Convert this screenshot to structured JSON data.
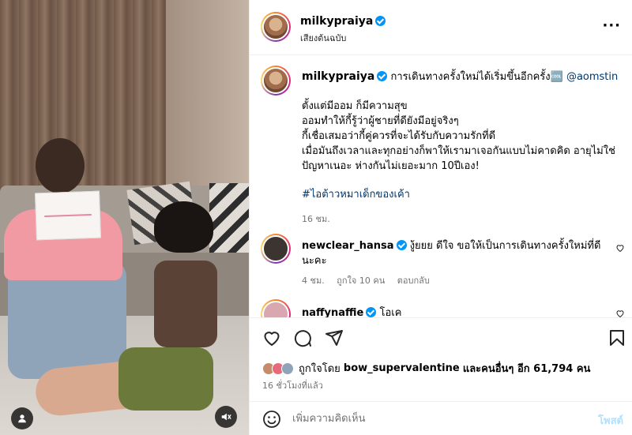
{
  "post": {
    "username": "milkypraiya",
    "audio_label": "เสียงต้นฉบับ",
    "caption_headline": "การเดินทางครั้งใหม่ได้เริ่มขึ้นอีกครั้ง",
    "caption_gif_glyph": "🆒",
    "caption_mention": "@aomstin",
    "caption_lines": [
      "ตั้งแต่มีออม ก็มีความสุข",
      "ออมทำให้กี้รู้ว่าผู้ชายที่ดียังมีอยู่จริงๆ",
      "กี้เชื่อเสมอว่ากี้คู่ควรที่จะได้รับกับความรักที่ดี",
      "เมื่อมันถึงเวลาและทุกอย่างก็พาให้เรามาเจอกันแบบไม่คาดคิด อายุไม่ใช่ปัญหาเนอะ ห่างกันไม่เยอะมาก 10ปีเอง!"
    ],
    "hashtag": "#ไอต้าวหมาเด็กของเค้า",
    "caption_time": "16 ชม."
  },
  "comments": [
    {
      "username": "newclear_hansa",
      "text": "งู้ยยย ดีใจ ขอให้เป็นการเดินทางครั้งใหม่ที่ดีนะคะ",
      "time": "4 ชม.",
      "likes": "ถูกใจ 10 คน",
      "reply": "ตอบกลับ",
      "avatar_color": "#3b3431"
    },
    {
      "username": "naffynaffie",
      "text": "โอเค",
      "avatar_color": "#d8a7b0"
    }
  ],
  "likes": {
    "prefix": "ถูกใจโดย",
    "user": "bow_supervalentine",
    "suffix": "และคนอื่นๆ อีก 61,794 คน"
  },
  "time_ago": "16 ชั่วโมงที่แล้ว",
  "composer": {
    "placeholder": "เพิ่มความคิดเห็น",
    "post_label": "โพสต์"
  },
  "colors": {
    "link": "#00376b",
    "verified": "#0095f6",
    "muted": "#737373",
    "post_disabled": "#b2dffc"
  },
  "icons": [
    "more-icon",
    "heart-icon",
    "comment-icon",
    "share-icon",
    "bookmark-icon",
    "emoji-icon",
    "mute-icon",
    "user-tag-icon",
    "verified-icon"
  ]
}
